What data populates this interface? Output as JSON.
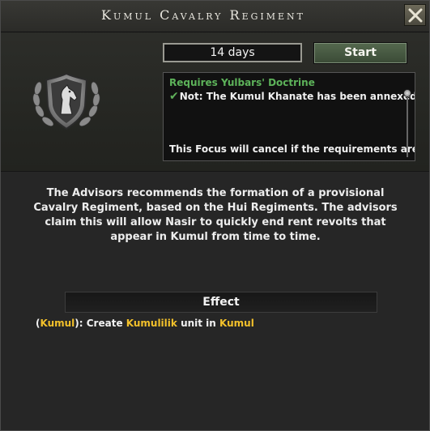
{
  "window": {
    "title": "Kumul Cavalry Regiment",
    "close_icon": "close-x-icon"
  },
  "focus": {
    "duration": "14 days",
    "start_label": "Start",
    "emblem_icon": "horse-head-shield-icon"
  },
  "requirements": {
    "title": "Requires Yulbars' Doctrine",
    "condition_icon": "checkmark-icon",
    "condition": "Not: The Kumul Khanate has been annexed.",
    "cancel_notice": "This Focus will cancel if the requirements are"
  },
  "description": "The Advisors recommends the formation of a provisional Cavalry Regiment, based on the Hui Regiments. The advisors claim this will allow Nasir to quickly end rent revolts that appear in Kumul from time to time.",
  "effect": {
    "header": "Effect",
    "open_paren": "(",
    "country": "Kumul",
    "close_text": "): Create ",
    "unit": "Kumulilik",
    "middle": " unit in ",
    "location": "Kumul"
  },
  "colors": {
    "requirement_green": "#5db35a",
    "highlight_yellow": "#f3c12b",
    "start_button_green": "#4a5c45"
  }
}
